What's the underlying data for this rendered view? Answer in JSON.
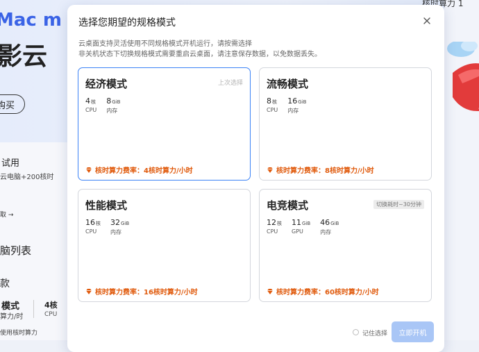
{
  "background": {
    "hero_title_line1": "Mac m",
    "hero_title_line2": "影云",
    "buy_button": "购买",
    "trial_title": "试用",
    "trial_sub": "云电脑+200核时",
    "trial_more": "取 →",
    "pc_list": "脑列表",
    "section": "款",
    "mode_name": "模式",
    "mode_sub": "算力/时",
    "cpu_num": "4核",
    "cpu_label": "CPU",
    "use_hint": "使用核时算力",
    "top_right_text": "核时算力 1"
  },
  "modal": {
    "title": "选择您期望的规格模式",
    "desc_line1": "云桌面支持灵活使用不同规格模式开机运行，请按需选择",
    "desc_line2": "非关机状态下切换规格模式需要重启云桌面，请注意保存数据，以免数据丢失。",
    "remember_label": "记住选择",
    "start_button": "立即开机",
    "modes": [
      {
        "name": "经济模式",
        "tag": "上次选择",
        "selected": true,
        "specs": [
          {
            "value": "4",
            "unit": "核",
            "label": "CPU"
          },
          {
            "value": "8",
            "unit": "GiB",
            "label": "内存"
          }
        ],
        "rate": "核时算力费率：4核时算力/小时"
      },
      {
        "name": "流畅模式",
        "tag": "",
        "selected": false,
        "specs": [
          {
            "value": "8",
            "unit": "核",
            "label": "CPU"
          },
          {
            "value": "16",
            "unit": "GiB",
            "label": "内存"
          }
        ],
        "rate": "核时算力费率：8核时算力/小时"
      },
      {
        "name": "性能模式",
        "tag": "",
        "selected": false,
        "specs": [
          {
            "value": "16",
            "unit": "核",
            "label": "CPU"
          },
          {
            "value": "32",
            "unit": "GiB",
            "label": "内存"
          }
        ],
        "rate": "核时算力费率：16核时算力/小时"
      },
      {
        "name": "电竞模式",
        "tag": "切换耗时~30分钟",
        "selected": false,
        "specs": [
          {
            "value": "12",
            "unit": "核",
            "label": "CPU"
          },
          {
            "value": "11",
            "unit": "GiB",
            "label": "GPU"
          },
          {
            "value": "46",
            "unit": "GiB",
            "label": "内存"
          }
        ],
        "rate": "核时算力费率：60核时算力/小时"
      }
    ]
  },
  "colors": {
    "accent": "#3b82f6",
    "rate": "#e05a0c",
    "button_disabled": "#a9c6f6"
  },
  "icons": [
    "close-icon",
    "diamond-icon",
    "radio-icon"
  ]
}
